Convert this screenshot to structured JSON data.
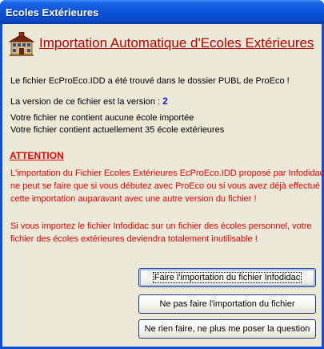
{
  "window": {
    "title": "Ecoles Extérieures"
  },
  "header": {
    "icon": "school-building-icon",
    "title": "Importation Automatique d'Ecoles Extérieures"
  },
  "info": {
    "file_found": "Le fichier EcProEco.IDD a été trouvé dans le dossier PUBL de ProEco !",
    "version_label": "La version de ce fichier est la version :",
    "version_value": "2",
    "no_school": "Votre fichier ne contient aucune école importée",
    "school_count": "Votre fichier contient actuellement 35 école extérieures"
  },
  "warning": {
    "title": "ATTENTION",
    "lines_1": [
      "L'importation du Fichier Ecoles Extérieures EcProEco.IDD proposé par Infodidac",
      "ne peut se faire que si vous débutez avec ProEco ou si vous avez déjà effectué",
      "cette importation auparavant avec une autre version du fichier !"
    ],
    "lines_2": [
      "Si vous importez le fichier Infodidac sur un fichier des écoles personnel, votre",
      "fichier des écoles extérieures deviendra totalement inutilisable !"
    ]
  },
  "buttons": {
    "import": "Faire l'importation du fichier Infodidac",
    "skip": "Ne pas faire l'importation du fichier",
    "never": "Ne rien faire, ne plus me poser la question"
  },
  "colors": {
    "accent_red": "#e00000",
    "title_red": "#b20000",
    "version_blue": "#1717d6"
  }
}
